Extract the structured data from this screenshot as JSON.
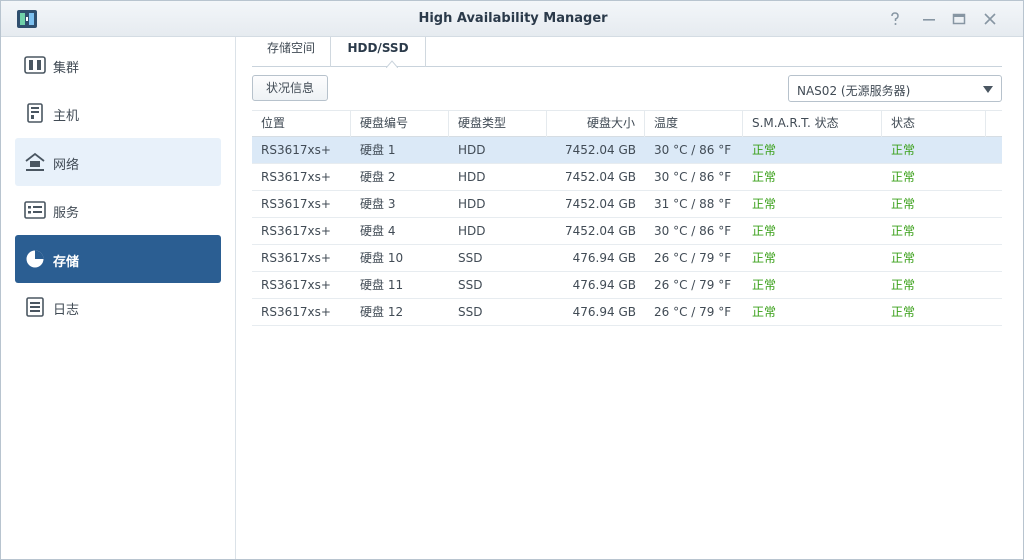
{
  "window": {
    "title": "High Availability Manager"
  },
  "titlebar": {
    "help_glyph": "?",
    "minimize_glyph": "—",
    "maximize_glyph": "□",
    "close_glyph": "✕"
  },
  "sidebar": {
    "items": [
      {
        "label": "集群",
        "icon": "cluster-icon",
        "state": "normal"
      },
      {
        "label": "主机",
        "icon": "host-icon",
        "state": "normal"
      },
      {
        "label": "网络",
        "icon": "network-icon",
        "state": "hover"
      },
      {
        "label": "服务",
        "icon": "service-icon",
        "state": "normal"
      },
      {
        "label": "存储",
        "icon": "storage-icon",
        "state": "active"
      },
      {
        "label": "日志",
        "icon": "log-icon",
        "state": "normal"
      }
    ]
  },
  "tabs": [
    {
      "label": "存储空间",
      "active": false
    },
    {
      "label": "HDD/SSD",
      "active": true
    }
  ],
  "toolbar": {
    "status_button": "状况信息"
  },
  "server_select": {
    "value": "NAS02 (无源服务器)"
  },
  "table": {
    "columns": [
      "位置",
      "硬盘编号",
      "硬盘类型",
      "硬盘大小",
      "温度",
      "S.M.A.R.T. 状态",
      "状态"
    ],
    "rows": [
      {
        "location": "RS3617xs+",
        "disk": "硬盘 1",
        "type": "HDD",
        "size": "7452.04 GB",
        "temp": "30 °C / 86 °F",
        "smart": "正常",
        "status": "正常",
        "selected": true
      },
      {
        "location": "RS3617xs+",
        "disk": "硬盘 2",
        "type": "HDD",
        "size": "7452.04 GB",
        "temp": "30 °C / 86 °F",
        "smart": "正常",
        "status": "正常",
        "selected": false
      },
      {
        "location": "RS3617xs+",
        "disk": "硬盘 3",
        "type": "HDD",
        "size": "7452.04 GB",
        "temp": "31 °C / 88 °F",
        "smart": "正常",
        "status": "正常",
        "selected": false
      },
      {
        "location": "RS3617xs+",
        "disk": "硬盘 4",
        "type": "HDD",
        "size": "7452.04 GB",
        "temp": "30 °C / 86 °F",
        "smart": "正常",
        "status": "正常",
        "selected": false
      },
      {
        "location": "RS3617xs+",
        "disk": "硬盘 10",
        "type": "SSD",
        "size": "476.94 GB",
        "temp": "26 °C / 79 °F",
        "smart": "正常",
        "status": "正常",
        "selected": false
      },
      {
        "location": "RS3617xs+",
        "disk": "硬盘 11",
        "type": "SSD",
        "size": "476.94 GB",
        "temp": "26 °C / 79 °F",
        "smart": "正常",
        "status": "正常",
        "selected": false
      },
      {
        "location": "RS3617xs+",
        "disk": "硬盘 12",
        "type": "SSD",
        "size": "476.94 GB",
        "temp": "26 °C / 79 °F",
        "smart": "正常",
        "status": "正常",
        "selected": false
      }
    ]
  },
  "colors": {
    "accent": "#2b5e92",
    "ok": "#3aa019",
    "selected_row": "#dbe9f7",
    "hover": "#e8f1fa"
  }
}
